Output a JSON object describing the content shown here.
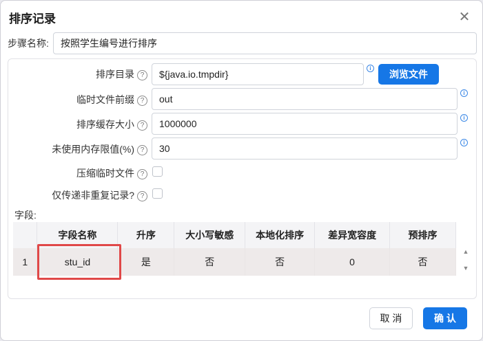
{
  "dialog": {
    "title": "排序记录",
    "close_glyph": "✕"
  },
  "step": {
    "label": "步骤名称:",
    "value": "按照学生编号进行排序"
  },
  "form": {
    "sort_dir": {
      "label": "排序目录",
      "value": "${java.io.tmpdir}",
      "browse_button": "浏览文件"
    },
    "temp_prefix": {
      "label": "临时文件前缀",
      "value": "out"
    },
    "buffer_size": {
      "label": "排序缓存大小",
      "value": "1000000"
    },
    "mem_limit": {
      "label": "未使用内存限值(%)",
      "value": "30"
    },
    "compress": {
      "label": "压缩临时文件"
    },
    "unique_only": {
      "label": "仅传递非重复记录?"
    },
    "help_glyph": "?",
    "info_glyph": "i"
  },
  "fields": {
    "label": "字段:",
    "columns": [
      "",
      "字段名称",
      "升序",
      "大小写敏感",
      "本地化排序",
      "差异宽容度",
      "预排序"
    ],
    "rows": [
      [
        "1",
        "stu_id",
        "是",
        "否",
        "否",
        "0",
        "否"
      ]
    ]
  },
  "buttons": {
    "cancel": "取 消",
    "ok": "确 认"
  },
  "scroll": {
    "up": "▲",
    "down": "▼"
  }
}
